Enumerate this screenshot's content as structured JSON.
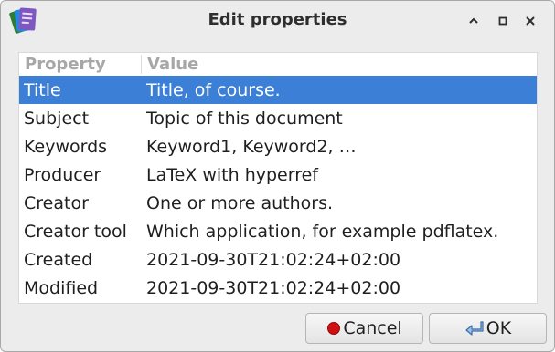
{
  "window": {
    "title": "Edit properties",
    "app_icon": "document-properties-icon",
    "controls": [
      "minimize-icon",
      "maximize-icon",
      "close-icon"
    ]
  },
  "table": {
    "columns": [
      "Property",
      "Value"
    ],
    "selected_index": 0,
    "rows": [
      {
        "key": "Title",
        "value": "Title, of course."
      },
      {
        "key": "Subject",
        "value": "Topic of this document"
      },
      {
        "key": "Keywords",
        "value": "Keyword1, Keyword2, …"
      },
      {
        "key": "Producer",
        "value": "LaTeX with hyperref"
      },
      {
        "key": "Creator",
        "value": "One or more authors."
      },
      {
        "key": "Creator tool",
        "value": "Which application, for example pdflatex."
      },
      {
        "key": "Created",
        "value": "2021-09-30T21:02:24+02:00"
      },
      {
        "key": "Modified",
        "value": "2021-09-30T21:02:24+02:00"
      }
    ]
  },
  "buttons": {
    "cancel_label": "Cancel",
    "cancel_icon": "stop-icon",
    "ok_label": "OK",
    "ok_icon": "enter-arrow-icon"
  },
  "colors": {
    "selection": "#3b80d6",
    "header_text": "#a7a7a7",
    "window_bg": "#ececec",
    "cancel_dot": "#d01010"
  }
}
